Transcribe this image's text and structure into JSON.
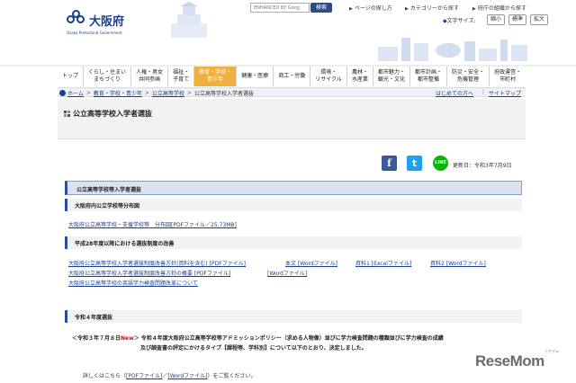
{
  "header": {
    "logo_name": "大阪府",
    "logo_sub": "Osaka Prefectural Government",
    "search_placeholder": "ENHANCED BY Goog",
    "search_button": "検索",
    "top_links": [
      "ページの探し方",
      "カテゴリーから探す",
      "府庁の組織から探す"
    ],
    "text_size_label": "文字サイズ:",
    "text_size_buttons": [
      "縮小",
      "標準",
      "拡大"
    ]
  },
  "nav": {
    "items": [
      {
        "label": "トップ"
      },
      {
        "label": "くらし・住まい\nまちづくり"
      },
      {
        "label": "人権・男女\n共同参画"
      },
      {
        "label": "福祉・\n子育て"
      },
      {
        "label": "教育・学校・\n青少年",
        "active": true
      },
      {
        "label": "健康・医療"
      },
      {
        "label": "商工・労働"
      },
      {
        "label": "環境・\nリサイクル"
      },
      {
        "label": "農林・\n水産業"
      },
      {
        "label": "都市魅力・\n観光・文化"
      },
      {
        "label": "都市計画・\n都市整備"
      },
      {
        "label": "防災・安全・\n危機管理"
      },
      {
        "label": "府政運営・\n市町村"
      }
    ]
  },
  "breadcrumb": {
    "items": [
      "ホーム",
      "教育・学校・青少年",
      "公立高等学校",
      "公立高等学校入学者選抜"
    ],
    "right_links": [
      "はじめての方へ",
      "サイトマップ"
    ]
  },
  "page": {
    "title": "公立高等学校入学者選抜",
    "updated": "更新日：令和3年7月9日",
    "sns": {
      "facebook": "f",
      "twitter": "t",
      "line": "LINE"
    }
  },
  "main": {
    "section_heading": "公立高等学校等入学者選抜",
    "sections": [
      {
        "heading": "大阪府内公立学校等分布図",
        "links": [
          "大阪府公立高等学校・支援学校等　分布図[PDFファイル／25.73MB]"
        ]
      },
      {
        "heading": "平成28年度以降における選抜制度の改善",
        "links_row1": [
          "大阪府公立高等学校入学者選抜制度改善方針(資料を含む) [PDFファイル]",
          "本文 [Wordファイル]",
          "資料1 [Excelファイル]",
          "資料2 [Wordファイル]"
        ],
        "links_row2": [
          "大阪府公立高等学校入学者選抜制度改善方針の概要 [PDFファイル]",
          "[Wordファイル]"
        ],
        "links_row3": [
          "大阪府公立高等学校の英語学力検査問題改革について"
        ]
      },
      {
        "heading": "令和４年度選抜",
        "notice_prefix": "＜令和３年７月８日",
        "notice_new": "New",
        "notice_line1": "＞ 令和４年度大阪府公立高等学校等アドミッションポリシー（求める人物像）並びに学力検査問題の種類並びに学力検査の成績",
        "notice_line2": "及び調査書の評定にかけるタイプ【課程等、学科別】について以下のとおり、決定しました。",
        "detail_prefix": "詳しくはこちら（",
        "detail_link1": "[PDFファイル]",
        "detail_sep": "／",
        "detail_link2": "[Wordファイル]",
        "detail_suffix": "）をご覧ください。"
      }
    ]
  },
  "watermark": {
    "text": "ReseMom",
    "sub": "リセマム"
  },
  "colors": {
    "brand": "#1a3f8f",
    "nav_active": "#f0b040",
    "new": "#e60000"
  }
}
